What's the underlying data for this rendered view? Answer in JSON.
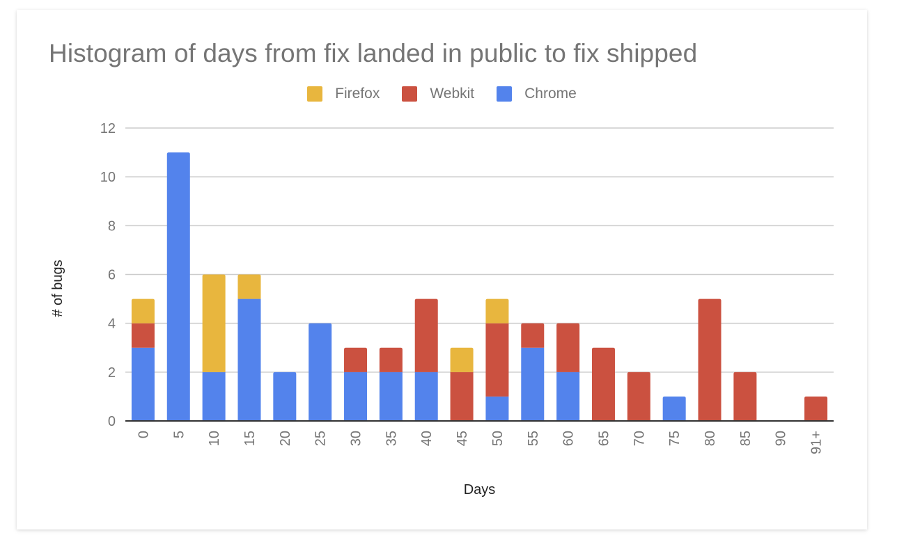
{
  "chart_data": {
    "type": "bar",
    "stacked": true,
    "title": "Histogram of days from fix landed in public to fix shipped",
    "xlabel": "Days",
    "ylabel": "# of bugs",
    "ylim": [
      0,
      12
    ],
    "yticks": [
      0,
      2,
      4,
      6,
      8,
      10,
      12
    ],
    "grid": true,
    "legend_position": "top",
    "categories": [
      "0",
      "5",
      "10",
      "15",
      "20",
      "25",
      "30",
      "35",
      "40",
      "45",
      "50",
      "55",
      "60",
      "65",
      "70",
      "75",
      "80",
      "85",
      "90",
      "91+"
    ],
    "series": [
      {
        "name": "Chrome",
        "color": "#5383EC",
        "values": [
          3,
          11,
          2,
          5,
          2,
          4,
          2,
          2,
          2,
          0,
          1,
          3,
          2,
          0,
          0,
          1,
          0,
          0,
          0,
          0
        ]
      },
      {
        "name": "Webkit",
        "color": "#CB5140",
        "values": [
          1,
          0,
          0,
          0,
          0,
          0,
          1,
          1,
          3,
          2,
          3,
          1,
          2,
          3,
          2,
          0,
          5,
          2,
          0,
          1
        ]
      },
      {
        "name": "Firefox",
        "color": "#E8B63E",
        "values": [
          1,
          0,
          4,
          1,
          0,
          0,
          0,
          0,
          0,
          1,
          1,
          0,
          0,
          0,
          0,
          0,
          0,
          0,
          0,
          0
        ]
      }
    ],
    "legend_order": [
      "Firefox",
      "Webkit",
      "Chrome"
    ]
  },
  "colors": {
    "gridline": "#cccccc",
    "baseline": "#333333",
    "text": "#757575"
  }
}
